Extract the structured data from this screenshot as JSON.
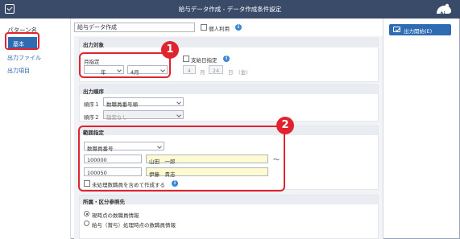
{
  "window": {
    "title": "給与データ作成 - データ作成条件設定"
  },
  "sidebar": {
    "header": "パターン名",
    "items": [
      {
        "label": "基本"
      },
      {
        "label": "出力ファイル"
      },
      {
        "label": "出力項目"
      }
    ]
  },
  "pattern": {
    "name_value": "給与データ作成",
    "personal_use_label": "個人利用"
  },
  "buttons": {
    "start_output": "出力開始(E)"
  },
  "output_target": {
    "header": "出力対象",
    "month_spec_label": "月指定",
    "year_suffix": "年",
    "month_value": "4月",
    "payday_spec_label": "支給日指定",
    "payday_month": "4",
    "month_unit": "月",
    "payday_day": "24",
    "day_unit": "日",
    "weekday": "(金)"
  },
  "output_order": {
    "header": "出力順序",
    "order1_label": "順序１",
    "order1_value": "数職員番号順",
    "order2_label": "順序２",
    "order2_value": "設定なし"
  },
  "range": {
    "header": "範囲指定",
    "type_value": "数職員番号",
    "from_code": "100000",
    "from_name": "山田　一郎",
    "tilde": "～",
    "to_code": "100050",
    "to_name": "伊藤　貴志",
    "include_unprocessed_label": "未処理数職員を含めて作成する"
  },
  "affiliation": {
    "header": "所属・区分参照先",
    "option1": "現時点の数職員情報",
    "option2": "給与（賞与）処理時点の数職員情報"
  },
  "callouts": {
    "badge1": "1",
    "badge2": "2"
  },
  "colors": {
    "titlebar": "#3a4b6a",
    "accent": "#2f6bb3",
    "callout": "#e0242f",
    "name_field": "#fefbd2"
  }
}
